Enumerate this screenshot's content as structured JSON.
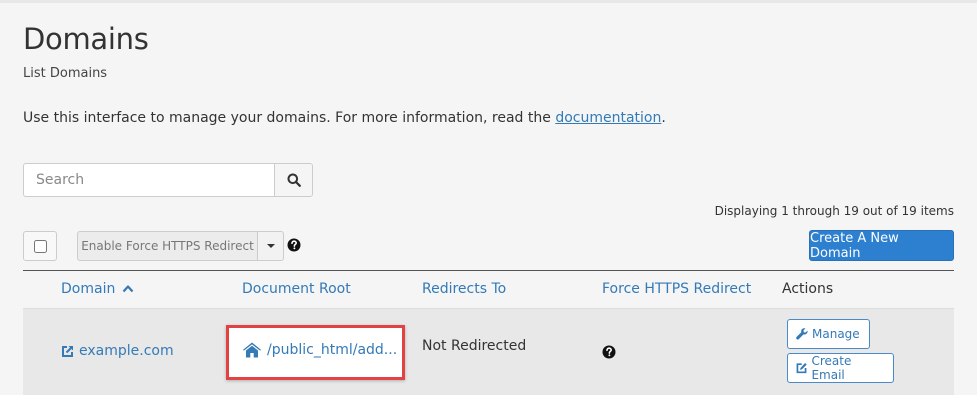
{
  "page": {
    "title": "Domains",
    "subtitle": "List Domains",
    "intro_text": "Use this interface to manage your domains. For more information, read the ",
    "intro_link": "documentation",
    "intro_end": "."
  },
  "search": {
    "placeholder": "Search",
    "value": ""
  },
  "toolbar": {
    "display_count": "Displaying 1 through 19 out of 19 items",
    "https_button": "Enable Force HTTPS Redirect",
    "create_button": "Create A New Domain"
  },
  "table": {
    "headers": {
      "domain": "Domain",
      "document_root": "Document Root",
      "redirects_to": "Redirects To",
      "force_https": "Force HTTPS Redirect",
      "actions": "Actions"
    },
    "sort": {
      "column": "domain",
      "direction": "ascending"
    },
    "rows": [
      {
        "domain": "example.com",
        "document_root": "/public_html/add...",
        "redirects_to": "Not Redirected",
        "actions": {
          "manage": "Manage",
          "create_email": "Create Email"
        }
      }
    ]
  },
  "colors": {
    "link": "#337ab7",
    "primary_button": "#2d7fcf",
    "highlight_border": "#e34242",
    "row_background": "#e8e8e8"
  },
  "icons": [
    "search-icon",
    "caret-down-icon",
    "question-circle-icon",
    "chevron-up-icon",
    "external-link-icon",
    "home-icon",
    "wrench-icon",
    "edit-icon"
  ]
}
